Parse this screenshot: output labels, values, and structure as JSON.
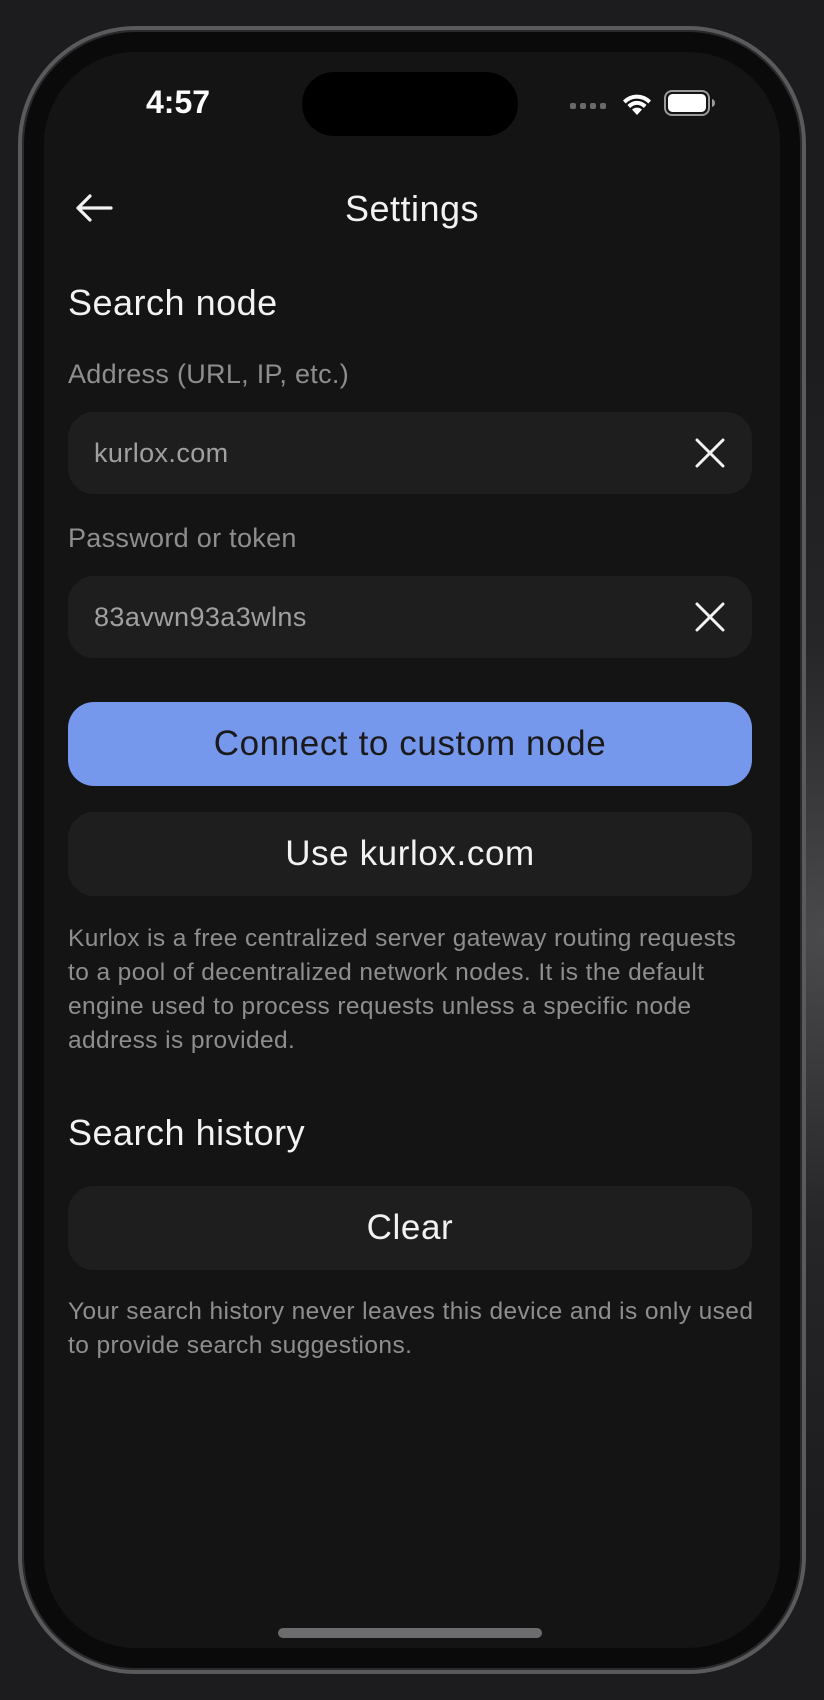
{
  "status_bar": {
    "time": "4:57",
    "icons": [
      "signal-dots-icon",
      "wifi-icon",
      "battery-icon"
    ]
  },
  "nav": {
    "back_icon": "arrow-left-icon",
    "title": "Settings"
  },
  "search_node": {
    "title": "Search node",
    "address_label": "Address (URL, IP, etc.)",
    "address_value": "kurlox.com",
    "password_label": "Password or token",
    "password_value": "83avwn93a3wlns",
    "connect_button": "Connect to custom node",
    "use_default_button": "Use kurlox.com",
    "description": "Kurlox is a free centralized server gateway routing requests to a pool of decentralized network nodes. It is the default engine used to process requests unless a specific node address is provided."
  },
  "search_history": {
    "title": "Search history",
    "clear_button": "Clear",
    "description": "Your search history never leaves this device and is only used to provide search suggestions."
  },
  "colors": {
    "background": "#141414",
    "surface": "#1e1e1e",
    "accent": "#7698ec",
    "text_primary": "#f2f2f2",
    "text_secondary": "#8e8e90"
  }
}
